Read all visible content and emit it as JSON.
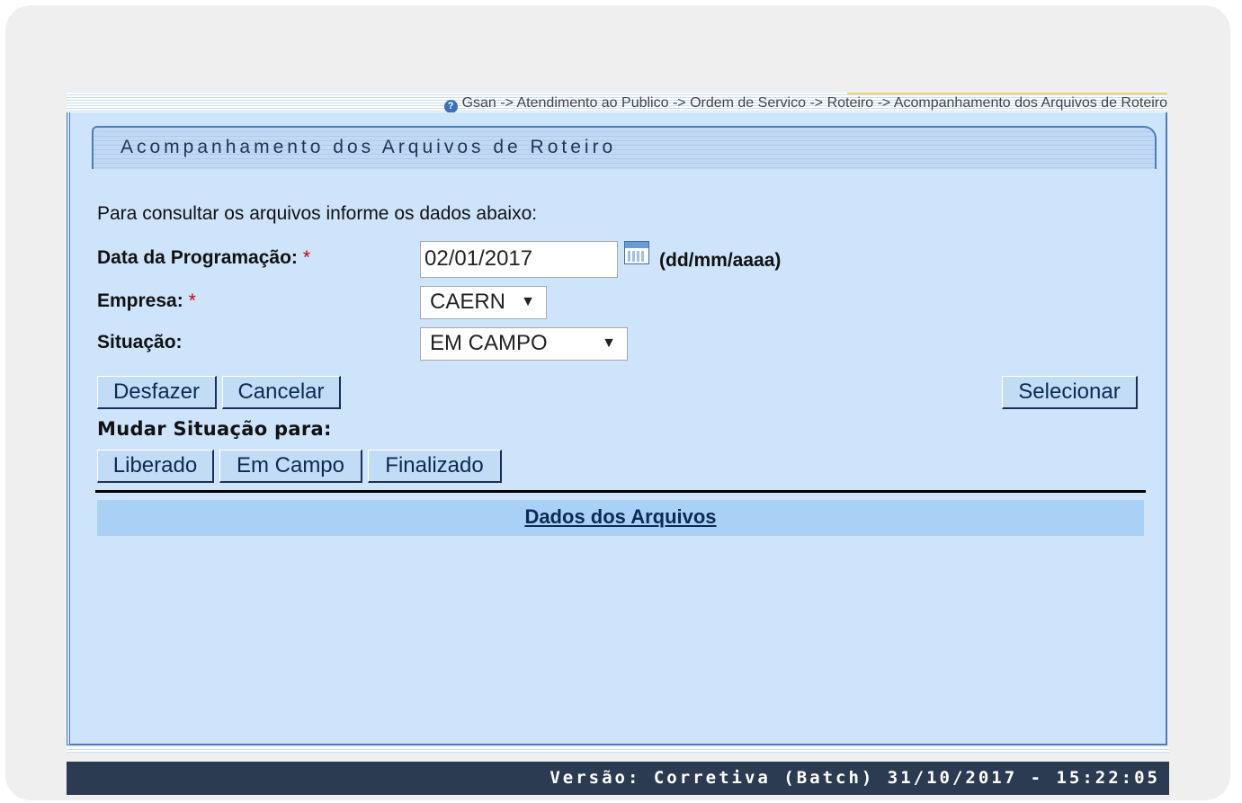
{
  "breadcrumb": {
    "help_icon": "help-icon",
    "text": "Gsan -> Atendimento ao Publico -> Ordem de Servico -> Roteiro -> Acompanhamento dos Arquivos de Roteiro"
  },
  "page": {
    "title": "Acompanhamento dos Arquivos de Roteiro",
    "instructions": "Para consultar os arquivos informe os dados abaixo:"
  },
  "form": {
    "data_programacao": {
      "label": "Data da Programação:",
      "required_mark": "*",
      "value": "02/01/2017",
      "format_hint": "(dd/mm/aaaa)",
      "calendar_icon": "calendar-icon"
    },
    "empresa": {
      "label": "Empresa:",
      "required_mark": "*",
      "selected": "CAERN"
    },
    "situacao": {
      "label": "Situação:",
      "selected": "EM CAMPO"
    }
  },
  "buttons": {
    "desfazer": "Desfazer",
    "cancelar": "Cancelar",
    "selecionar": "Selecionar"
  },
  "mudar_situacao": {
    "label": "Mudar Situação para:",
    "liberado": "Liberado",
    "em_campo": "Em Campo",
    "finalizado": "Finalizado"
  },
  "dados_arquivos": {
    "header": "Dados dos Arquivos"
  },
  "footer": {
    "version": "Versão: Corretiva (Batch) 31/10/2017 - 15:22:05"
  },
  "colors": {
    "panel_bg": "#cde4fb",
    "button_bg": "#c2dcf5",
    "footer_bg": "#2b3c52",
    "required": "#d00000"
  }
}
